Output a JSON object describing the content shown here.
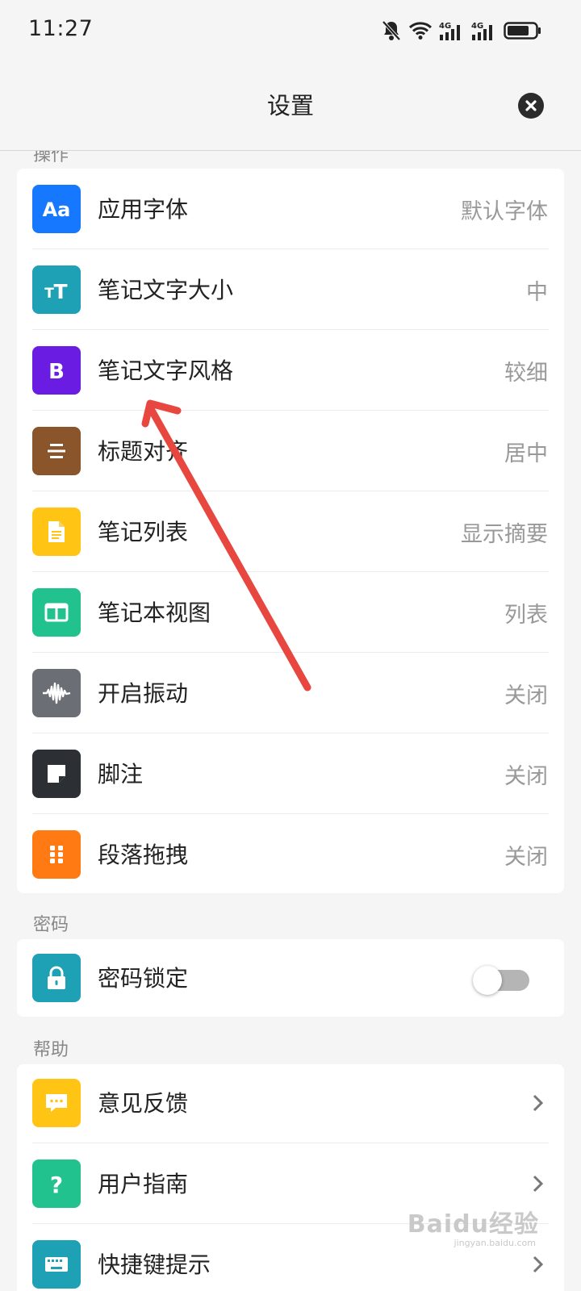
{
  "status_bar": {
    "time": "11:27",
    "icons": [
      "bell-muted-icon",
      "wifi-icon",
      "signal-4g-icon",
      "signal-4g-icon",
      "battery-icon"
    ],
    "network_1": "4G",
    "network_2": "4G"
  },
  "header": {
    "title": "设置",
    "close_icon": "close-icon"
  },
  "sections": {
    "operations": {
      "label": "操作",
      "items": [
        {
          "label": "应用字体",
          "value": "默认字体",
          "icon": "font-aa-icon",
          "color": "#1677ff"
        },
        {
          "label": "笔记文字大小",
          "value": "中",
          "icon": "text-size-icon",
          "color": "#1ea0b5"
        },
        {
          "label": "笔记文字风格",
          "value": "较细",
          "icon": "bold-b-icon",
          "color": "#6a1ce3"
        },
        {
          "label": "标题对齐",
          "value": "居中",
          "icon": "align-center-icon",
          "color": "#8a552a"
        },
        {
          "label": "笔记列表",
          "value": "显示摘要",
          "icon": "document-icon",
          "color": "#ffc414"
        },
        {
          "label": "笔记本视图",
          "value": "列表",
          "icon": "columns-icon",
          "color": "#22c28f"
        },
        {
          "label": "开启振动",
          "value": "关闭",
          "icon": "waveform-icon",
          "color": "#6b6f75"
        },
        {
          "label": "脚注",
          "value": "关闭",
          "icon": "note-icon",
          "color": "#2c2f33"
        },
        {
          "label": "段落拖拽",
          "value": "关闭",
          "icon": "drag-handle-icon",
          "color": "#ff7a12"
        }
      ]
    },
    "password": {
      "label": "密码",
      "items": [
        {
          "label": "密码锁定",
          "toggle_on": false,
          "icon": "lock-icon",
          "color": "#1ea0b5"
        }
      ]
    },
    "help": {
      "label": "帮助",
      "items": [
        {
          "label": "意见反馈",
          "icon": "chat-bubble-icon",
          "color": "#ffc414"
        },
        {
          "label": "用户指南",
          "icon": "question-icon",
          "color": "#22c28f"
        },
        {
          "label": "快捷键提示",
          "icon": "keyboard-icon",
          "color": "#1ea0b5"
        }
      ]
    }
  },
  "annotation": {
    "color": "#e8473f"
  },
  "watermark": {
    "text": "Baidu经验",
    "sub": "jingyan.baidu.com"
  }
}
